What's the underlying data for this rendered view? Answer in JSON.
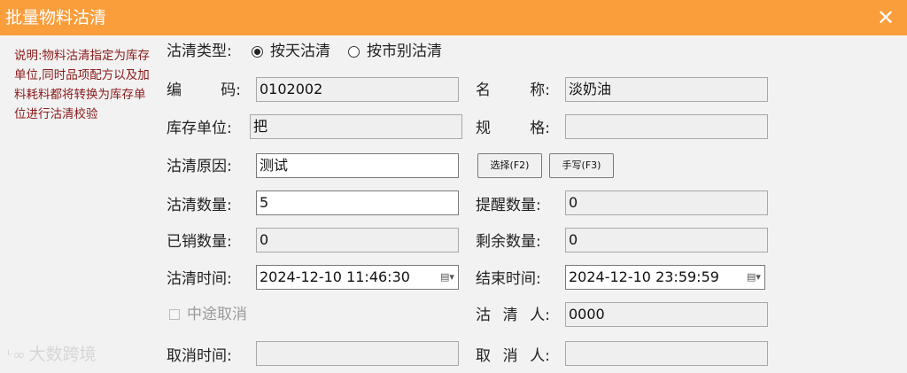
{
  "window": {
    "title": "批量物料沽清",
    "close_icon": "close-icon"
  },
  "note": "说明:物料沽清指定为库存单位,同时品项配方以及加料耗料都将转换为库存单位进行沽清校验",
  "type": {
    "label": "沽清类型:",
    "options": [
      "按天沽清",
      "按市别沽清"
    ],
    "selected": "按天沽清"
  },
  "fields": {
    "code": {
      "label": [
        "编",
        "码:"
      ],
      "value": "0102002"
    },
    "name": {
      "label": [
        "名",
        "称:"
      ],
      "value": "淡奶油"
    },
    "unit": {
      "label": "库存单位:",
      "value": "把"
    },
    "spec": {
      "label": [
        "规",
        "格:"
      ],
      "value": ""
    },
    "reason": {
      "label": "沽清原因:",
      "value": "测试"
    },
    "qty": {
      "label": "沽清数量:",
      "value": "5"
    },
    "remind": {
      "label": "提醒数量:",
      "value": "0"
    },
    "sold": {
      "label": "已销数量:",
      "value": "0"
    },
    "remain": {
      "label": "剩余数量:",
      "value": "0"
    },
    "start_time": {
      "label": "沽清时间:",
      "value": "2024-12-10 11:46:30"
    },
    "end_time": {
      "label": "结束时间:",
      "value": "2024-12-10 23:59:59"
    },
    "cancel_mid": {
      "label": "中途取消",
      "checked": false
    },
    "person": {
      "label": [
        "沽",
        "清",
        "人:"
      ],
      "value": "0000"
    },
    "cancel_time": {
      "label": "取消时间:",
      "value": ""
    },
    "cancel_person": {
      "label": [
        "取",
        "消",
        "人:"
      ],
      "value": ""
    }
  },
  "buttons": {
    "select": "选择(F2)",
    "manual": "手写(F3)"
  },
  "watermark": "大数跨境",
  "colors": {
    "titlebar": "#fa9d3b",
    "note": "#8b1a1a",
    "bg": "#f2f2f2"
  }
}
